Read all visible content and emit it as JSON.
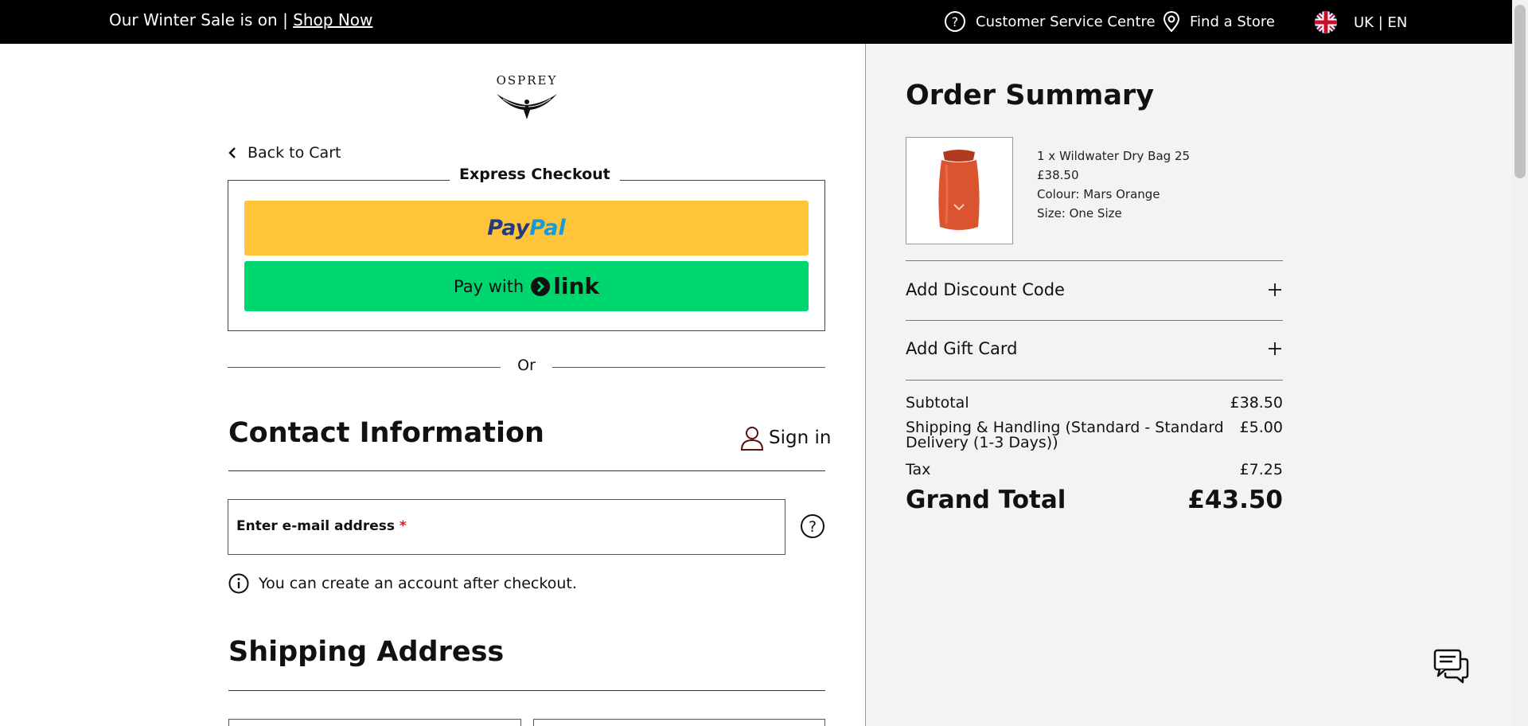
{
  "topbar": {
    "promo_text": "Our Winter Sale is on |",
    "promo_link": "Shop Now",
    "customer_service": "Customer Service Centre",
    "find_store": "Find a Store",
    "locale": "UK | EN"
  },
  "logo": {
    "text": "OSPREY"
  },
  "checkout": {
    "back_to_cart": "Back to Cart",
    "express_title": "Express Checkout",
    "paypal_part1": "Pay",
    "paypal_part2": "Pal",
    "link_prefix": "Pay with",
    "link_word": "link",
    "or_text": "Or",
    "contact_title": "Contact Information",
    "sign_in": "Sign in",
    "email_label": "Enter e-mail address",
    "required_mark": "*",
    "account_note": "You can create an account after checkout.",
    "shipping_title": "Shipping Address"
  },
  "summary": {
    "title": "Order Summary",
    "item": {
      "line1": "1 x Wildwater Dry Bag 25",
      "price": "£38.50",
      "colour": "Colour: Mars Orange",
      "size": "Size: One Size"
    },
    "discount_label": "Add Discount Code",
    "gift_label": "Add Gift Card",
    "subtotal_label": "Subtotal",
    "subtotal_value": "£38.50",
    "shipping_label": "Shipping & Handling (Standard - Standard Delivery (1-3 Days))",
    "shipping_value": "£5.00",
    "tax_label": "Tax",
    "tax_value": "£7.25",
    "grand_label": "Grand Total",
    "grand_value": "£43.50"
  },
  "colors": {
    "paypal_yellow": "#ffc439",
    "link_green": "#00d66f",
    "summary_bg": "#f3f3f3",
    "required_red": "#c0262d"
  }
}
